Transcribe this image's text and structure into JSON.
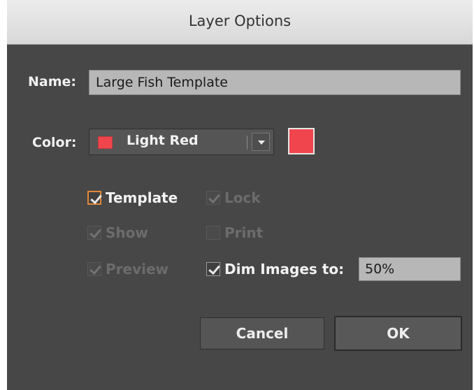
{
  "dialog": {
    "title": "Layer Options"
  },
  "name": {
    "label": "Name:",
    "value": "Large Fish Template"
  },
  "color": {
    "label": "Color:",
    "selected": "Light Red",
    "swatch_color": "#f0454d"
  },
  "options": {
    "template": {
      "label": "Template",
      "checked": true,
      "enabled": true,
      "focused": true
    },
    "lock": {
      "label": "Lock",
      "checked": true,
      "enabled": false
    },
    "show": {
      "label": "Show",
      "checked": true,
      "enabled": false
    },
    "print": {
      "label": "Print",
      "checked": false,
      "enabled": false
    },
    "preview": {
      "label": "Preview",
      "checked": true,
      "enabled": false
    },
    "dim_images": {
      "label": "Dim Images to:",
      "checked": true,
      "enabled": true,
      "value": "50%"
    }
  },
  "buttons": {
    "cancel": "Cancel",
    "ok": "OK"
  }
}
